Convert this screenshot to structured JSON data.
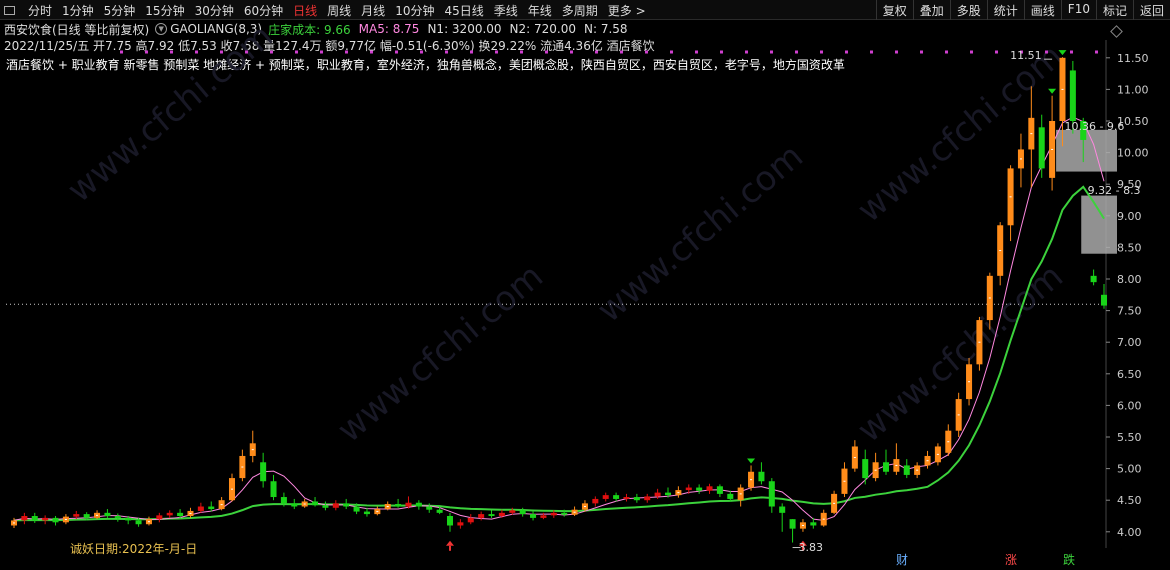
{
  "toolbar": {
    "periods": [
      "分时",
      "1分钟",
      "5分钟",
      "15分钟",
      "30分钟",
      "60分钟",
      "日线",
      "周线",
      "月线",
      "10分钟",
      "45日线",
      "季线",
      "年线",
      "多周期",
      "更多 >"
    ],
    "active_period": "日线",
    "right_buttons": [
      "复权",
      "叠加",
      "多股",
      "统计",
      "画线",
      "F10",
      "标记",
      "返回"
    ]
  },
  "header": {
    "title": "西安饮食(日线 等比前复权)",
    "indicator": "GAOLIANG(8,3)",
    "cost_label": "庄家成本: 9.66",
    "ma5_label": "MA5: 8.75",
    "n1_label": "N1: 3200.00",
    "n2_label": "N2: 720.00",
    "n_label": "N: 7.58",
    "ohlc_line": "2022/11/25/五 开7.75 高7.92 低7.53 收7.58 量127.4万 额9.77亿 幅-0.51(-6.30%) 换29.22% 流通4.36亿 酒店餐饮",
    "concepts": "酒店餐饮 + 职业教育 新零售 预制菜 地摊经济 + 预制菜，职业教育，室外经济，独角兽概念，美团概念股，陕西自贸区，西安自贸区，老字号，地方国资改革"
  },
  "colors": {
    "up": "#ff8c1a",
    "down": "#19d419",
    "red": "#e01010",
    "ma5": "#ff88e0",
    "cost": "#3cd23c",
    "zone": "#aaaaaa"
  },
  "chart_data": {
    "type": "candlestick",
    "y_ticks": [
      "11.50",
      "11.00",
      "10.50",
      "10.00",
      "9.50",
      "9.00",
      "8.50",
      "8.00",
      "7.50",
      "7.00",
      "6.50",
      "6.00",
      "5.50",
      "5.00",
      "4.50",
      "4.00"
    ],
    "ylim": [
      3.8,
      11.6
    ],
    "annotations": {
      "high": "11.51",
      "low": "3.83",
      "zone1": "10.36 - 9.6",
      "zone2": "9.32 - 8.3",
      "ref_price": 7.6
    },
    "markers": [
      "财",
      "涨",
      "跌"
    ],
    "footer": "诚妖日期:2022年-月-日",
    "candles": [
      [
        4.1,
        4.18,
        4.22,
        4.06
      ],
      [
        4.18,
        4.25,
        4.3,
        4.12
      ],
      [
        4.25,
        4.18,
        4.3,
        4.14
      ],
      [
        4.18,
        4.22,
        4.26,
        4.12
      ],
      [
        4.22,
        4.15,
        4.25,
        4.1
      ],
      [
        4.15,
        4.24,
        4.28,
        4.12
      ],
      [
        4.24,
        4.28,
        4.33,
        4.2
      ],
      [
        4.28,
        4.22,
        4.31,
        4.18
      ],
      [
        4.22,
        4.3,
        4.34,
        4.2
      ],
      [
        4.3,
        4.25,
        4.36,
        4.22
      ],
      [
        4.25,
        4.22,
        4.29,
        4.16
      ],
      [
        4.22,
        4.18,
        4.25,
        4.12
      ],
      [
        4.18,
        4.12,
        4.22,
        4.08
      ],
      [
        4.12,
        4.2,
        4.24,
        4.1
      ],
      [
        4.2,
        4.26,
        4.3,
        4.15
      ],
      [
        4.26,
        4.3,
        4.34,
        4.22
      ],
      [
        4.3,
        4.25,
        4.36,
        4.2
      ],
      [
        4.25,
        4.33,
        4.38,
        4.22
      ],
      [
        4.33,
        4.4,
        4.46,
        4.3
      ],
      [
        4.4,
        4.36,
        4.48,
        4.32
      ],
      [
        4.36,
        4.5,
        4.55,
        4.34
      ],
      [
        4.5,
        4.85,
        4.92,
        4.48
      ],
      [
        4.85,
        5.2,
        5.3,
        4.8
      ],
      [
        5.2,
        5.4,
        5.6,
        5.1
      ],
      [
        5.1,
        4.8,
        5.25,
        4.7
      ],
      [
        4.8,
        4.55,
        4.9,
        4.5
      ],
      [
        4.55,
        4.45,
        4.62,
        4.4
      ],
      [
        4.45,
        4.4,
        4.52,
        4.36
      ],
      [
        4.4,
        4.48,
        4.52,
        4.38
      ],
      [
        4.48,
        4.42,
        4.55,
        4.4
      ],
      [
        4.42,
        4.38,
        4.48,
        4.34
      ],
      [
        4.38,
        4.45,
        4.5,
        4.34
      ],
      [
        4.45,
        4.4,
        4.52,
        4.36
      ],
      [
        4.4,
        4.32,
        4.45,
        4.28
      ],
      [
        4.32,
        4.28,
        4.38,
        4.24
      ],
      [
        4.28,
        4.36,
        4.4,
        4.26
      ],
      [
        4.36,
        4.44,
        4.48,
        4.34
      ],
      [
        4.44,
        4.4,
        4.52,
        4.38
      ],
      [
        4.4,
        4.46,
        4.56,
        4.37
      ],
      [
        4.46,
        4.4,
        4.5,
        4.35
      ],
      [
        4.4,
        4.35,
        4.45,
        4.3
      ],
      [
        4.35,
        4.3,
        4.4,
        4.28
      ],
      [
        4.25,
        4.1,
        4.3,
        4.0
      ],
      [
        4.1,
        4.15,
        4.2,
        4.05
      ],
      [
        4.15,
        4.22,
        4.28,
        4.12
      ],
      [
        4.22,
        4.28,
        4.32,
        4.18
      ],
      [
        4.28,
        4.25,
        4.34,
        4.22
      ],
      [
        4.25,
        4.3,
        4.35,
        4.22
      ],
      [
        4.3,
        4.34,
        4.38,
        4.27
      ],
      [
        4.34,
        4.28,
        4.38,
        4.24
      ],
      [
        4.28,
        4.22,
        4.33,
        4.18
      ],
      [
        4.22,
        4.26,
        4.3,
        4.2
      ],
      [
        4.26,
        4.3,
        4.34,
        4.22
      ],
      [
        4.3,
        4.27,
        4.35,
        4.24
      ],
      [
        4.27,
        4.35,
        4.4,
        4.25
      ],
      [
        4.35,
        4.45,
        4.5,
        4.32
      ],
      [
        4.45,
        4.52,
        4.56,
        4.4
      ],
      [
        4.52,
        4.58,
        4.62,
        4.48
      ],
      [
        4.58,
        4.52,
        4.62,
        4.48
      ],
      [
        4.52,
        4.55,
        4.6,
        4.48
      ],
      [
        4.55,
        4.5,
        4.6,
        4.46
      ],
      [
        4.5,
        4.56,
        4.6,
        4.46
      ],
      [
        4.56,
        4.62,
        4.68,
        4.52
      ],
      [
        4.62,
        4.58,
        4.7,
        4.54
      ],
      [
        4.58,
        4.66,
        4.72,
        4.54
      ],
      [
        4.66,
        4.7,
        4.75,
        4.6
      ],
      [
        4.7,
        4.65,
        4.75,
        4.6
      ],
      [
        4.65,
        4.72,
        4.76,
        4.6
      ],
      [
        4.72,
        4.6,
        4.75,
        4.55
      ],
      [
        4.6,
        4.52,
        4.65,
        4.48
      ],
      [
        4.5,
        4.7,
        4.75,
        4.4
      ],
      [
        4.7,
        4.95,
        5.05,
        4.65
      ],
      [
        4.95,
        4.8,
        5.1,
        4.75
      ],
      [
        4.8,
        4.4,
        4.85,
        4.3
      ],
      [
        4.4,
        4.3,
        4.45,
        4.0
      ],
      [
        4.2,
        4.05,
        4.2,
        3.83
      ],
      [
        4.05,
        4.15,
        4.2,
        4.0
      ],
      [
        4.15,
        4.1,
        4.22,
        4.05
      ],
      [
        4.1,
        4.3,
        4.35,
        4.08
      ],
      [
        4.3,
        4.6,
        4.65,
        4.28
      ],
      [
        4.6,
        5.0,
        5.1,
        4.55
      ],
      [
        5.0,
        5.35,
        5.45,
        4.95
      ],
      [
        5.15,
        4.85,
        5.3,
        4.75
      ],
      [
        4.85,
        5.1,
        5.25,
        4.8
      ],
      [
        5.1,
        4.95,
        5.3,
        4.9
      ],
      [
        4.95,
        5.15,
        5.4,
        4.9
      ],
      [
        5.05,
        4.9,
        5.15,
        4.85
      ],
      [
        4.9,
        5.05,
        5.1,
        4.85
      ],
      [
        5.05,
        5.2,
        5.28,
        5.0
      ],
      [
        5.1,
        5.35,
        5.4,
        5.05
      ],
      [
        5.25,
        5.6,
        5.7,
        5.2
      ],
      [
        5.6,
        6.1,
        6.2,
        5.5
      ],
      [
        6.1,
        6.65,
        6.75,
        6.0
      ],
      [
        6.65,
        7.35,
        7.4,
        6.55
      ],
      [
        7.35,
        8.05,
        8.1,
        7.2
      ],
      [
        8.05,
        8.85,
        8.9,
        7.9
      ],
      [
        8.85,
        9.75,
        9.8,
        8.6
      ],
      [
        9.75,
        10.05,
        10.3,
        9.45
      ],
      [
        10.05,
        10.55,
        11.05,
        9.45
      ],
      [
        10.4,
        9.75,
        10.6,
        9.6
      ],
      [
        9.6,
        10.5,
        10.9,
        9.4
      ],
      [
        10.5,
        11.5,
        11.51,
        10.1
      ],
      [
        11.3,
        10.5,
        11.45,
        10.3
      ],
      [
        10.5,
        10.2,
        10.55,
        9.85
      ],
      [
        8.05,
        7.95,
        8.15,
        7.9
      ],
      [
        7.75,
        7.58,
        7.92,
        7.53
      ]
    ]
  }
}
